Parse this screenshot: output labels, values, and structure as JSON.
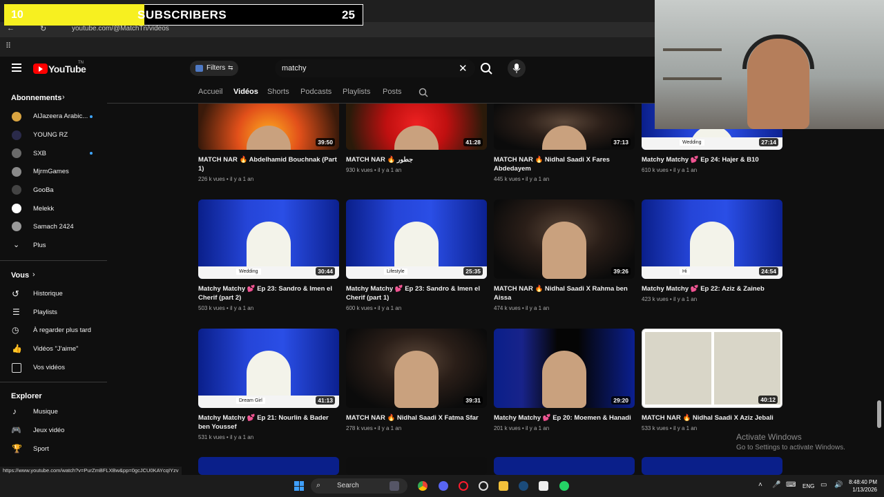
{
  "browser": {
    "url": "youtube.com/@MatchTn/videos"
  },
  "overlay": {
    "sub_count_left": "10",
    "sub_label": "SUBSCRIBERS",
    "sub_count_right": "25"
  },
  "header": {
    "logo": "YouTube",
    "logo_suffix": "TN",
    "filters": "Filters",
    "search_value": "matchy"
  },
  "tabs": [
    "Accueil",
    "Vidéos",
    "Shorts",
    "Podcasts",
    "Playlists",
    "Posts"
  ],
  "sidebar": {
    "subs_heading": "Abonnements",
    "subs": [
      "AlJazeera Arabic...",
      "YOUNG RZ",
      "SXB",
      "MjrmGames",
      "GooBa",
      "Melekk",
      "Samach 2424",
      "Plus"
    ],
    "you_heading": "Vous",
    "you": [
      "Historique",
      "Playlists",
      "À regarder plus tard",
      "Vidéos \"J'aime\"",
      "Vos vidéos"
    ],
    "explore_heading": "Explorer",
    "explore": [
      "Musique",
      "Jeux vidéo",
      "Sport"
    ]
  },
  "videos": [
    {
      "title": "MATCH NAR 🔥 Abdelhamid Bouchnak (Part 1)",
      "meta": "226 k vues • il y a 1 an",
      "duration": "39:50",
      "style": "fire"
    },
    {
      "title": "MATCH NAR 🔥 جطور",
      "meta": "930 k vues • il y a 1 an",
      "duration": "41:28",
      "style": "red"
    },
    {
      "title": "MATCH NAR 🔥 Nidhal Saadi X Fares Abdedayem",
      "meta": "445 k vues • il y a 1 an",
      "duration": "37:13",
      "style": "dark"
    },
    {
      "title": "Matchy Matchy 💕 Ep 24: Hajer & B10",
      "meta": "610 k vues • il y a 1 an",
      "duration": "27:14",
      "style": "blue",
      "tag": "Wedding"
    },
    {
      "title": "Matchy Matchy 💕 Ep 23: Sandro & Imen el Cherif (part 2)",
      "meta": "503 k vues • il y a 1 an",
      "duration": "30:44",
      "style": "blue",
      "tag": "Wedding"
    },
    {
      "title": "Matchy Matchy 💕 Ep 23: Sandro & Imen el Cherif (part 1)",
      "meta": "600 k vues • il y a 1 an",
      "duration": "25:35",
      "style": "blue",
      "tag": "Lifestyle"
    },
    {
      "title": "MATCH NAR 🔥 Nidhal Saadi X Rahma ben Aissa",
      "meta": "474 k vues • il y a 1 an",
      "duration": "39:26",
      "style": "dark"
    },
    {
      "title": "Matchy Matchy 💕 Ep 22: Aziz & Zaineb",
      "meta": "423 k vues • il y a 1 an",
      "duration": "24:54",
      "style": "blue",
      "tag": "Hi"
    },
    {
      "title": "Matchy Matchy 💕 Ep 21: Nourlin & Bader ben Youssef",
      "meta": "531 k vues • il y a 1 an",
      "duration": "41:13",
      "style": "blue",
      "tag": "Dream Girl"
    },
    {
      "title": "MATCH NAR 🔥 Nidhal Saadi X Fatma Sfar",
      "meta": "278 k vues • il y a 1 an",
      "duration": "39:31",
      "style": "dark"
    },
    {
      "title": "Matchy Matchy 💕 Ep 20: Moemen & Hanadi",
      "meta": "201 k vues • il y a 1 an",
      "duration": "29:20",
      "style": "bald"
    },
    {
      "title": "MATCH NAR 🔥 Nidhal Saadi X Aziz Jebali",
      "meta": "533 k vues • il y a 1 an",
      "duration": "40:12",
      "style": "split"
    }
  ],
  "windows": {
    "activate_title": "Activate Windows",
    "activate_sub": "Go to Settings to activate Windows."
  },
  "status_url": "https://www.youtube.com/watch?v=PurZmBFLXBw&pp=0gcJCU0KAYcqIYzv",
  "taskbar": {
    "search": "Search",
    "lang": "ENG",
    "time": "8:48:40 PM",
    "date": "1/13/2026"
  },
  "colors": {
    "yt_red": "#ff0000",
    "banner_yellow": "#f7f020",
    "link_blue": "#3ea6ff"
  }
}
